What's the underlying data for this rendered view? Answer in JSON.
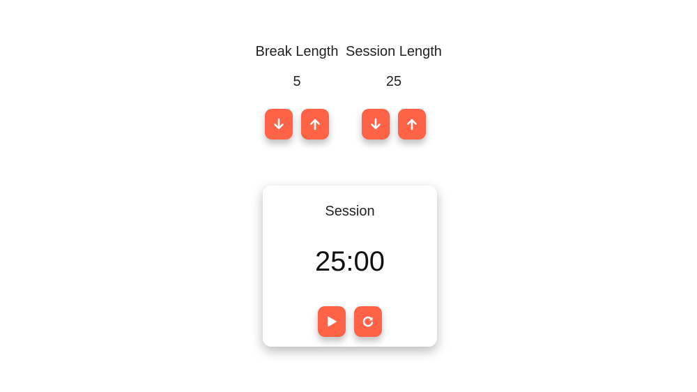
{
  "break": {
    "label": "Break Length",
    "value": "5",
    "decrement_icon": "arrow-down-icon",
    "increment_icon": "arrow-up-icon"
  },
  "session": {
    "label": "Session Length",
    "value": "25",
    "decrement_icon": "arrow-down-icon",
    "increment_icon": "arrow-up-icon"
  },
  "timer": {
    "label": "Session",
    "time": "25:00",
    "play_icon": "play-icon",
    "reset_icon": "reset-icon"
  },
  "colors": {
    "accent": "#ff6347",
    "text": "#222222",
    "background": "#ffffff"
  }
}
